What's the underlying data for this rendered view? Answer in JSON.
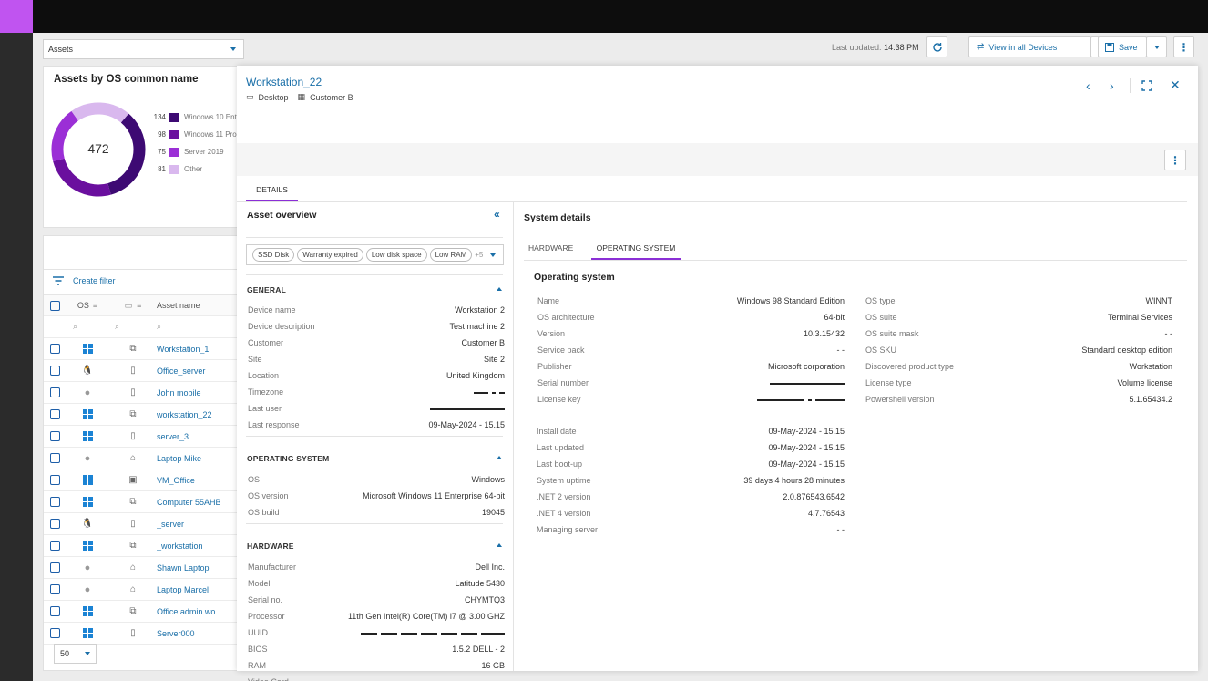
{
  "header": {
    "dropdown_value": "Assets",
    "last_updated_label": "Last updated:",
    "last_updated_time": "14:38 PM",
    "view_all_label": "View in all Devices",
    "save_label": "Save"
  },
  "os_card": {
    "title": "Assets by OS common name",
    "total": "472",
    "legend": [
      {
        "count": "134",
        "label": "Windows 10 Ent",
        "color": "#3d0a73"
      },
      {
        "count": "98",
        "label": "Windows 11 Pro",
        "color": "#6a0f9e"
      },
      {
        "count": "75",
        "label": "Server 2019",
        "color": "#9b2fd6"
      },
      {
        "count": "81",
        "label": "Other",
        "color": "#d9b8ee"
      }
    ]
  },
  "table": {
    "create_filter": "Create filter",
    "col_os": "OS",
    "col_asset": "Asset name",
    "rows": [
      {
        "os": "windows",
        "type": "desktop",
        "name": "Workstation_1"
      },
      {
        "os": "linux",
        "type": "mobile",
        "name": "Office_server"
      },
      {
        "os": "apple",
        "type": "mobile",
        "name": "John mobile"
      },
      {
        "os": "windows",
        "type": "desktop",
        "name": "workstation_22"
      },
      {
        "os": "windows",
        "type": "mobile",
        "name": "server_3"
      },
      {
        "os": "apple",
        "type": "laptop",
        "name": "Laptop Mike"
      },
      {
        "os": "windows",
        "type": "vm",
        "name": "VM_Office"
      },
      {
        "os": "windows",
        "type": "desktop",
        "name": "Computer 55AHB"
      },
      {
        "os": "linux",
        "type": "mobile",
        "name": "_server"
      },
      {
        "os": "windows",
        "type": "desktop",
        "name": "_workstation"
      },
      {
        "os": "apple",
        "type": "laptop",
        "name": "Shawn Laptop"
      },
      {
        "os": "apple",
        "type": "laptop",
        "name": "Laptop Marcel"
      },
      {
        "os": "windows",
        "type": "desktop",
        "name": "Office admin wo"
      },
      {
        "os": "windows",
        "type": "mobile",
        "name": "Server000"
      }
    ],
    "page_size": "50"
  },
  "panel": {
    "title": "Workstation_22",
    "type_label": "Desktop",
    "customer_label": "Customer B",
    "tab_details": "DETAILS",
    "asset_overview_title": "Asset overview",
    "tags": [
      "SSD Disk",
      "Warranty expired",
      "Low disk space",
      "Low RAM"
    ],
    "tags_more": "+5",
    "general": {
      "title": "GENERAL",
      "items": [
        {
          "k": "Device name",
          "v": "Workstation 2"
        },
        {
          "k": "Device description",
          "v": "Test machine 2"
        },
        {
          "k": "Customer",
          "v": "Customer B"
        },
        {
          "k": "Site",
          "v": "Site 2"
        },
        {
          "k": "Location",
          "v": "United Kingdom"
        },
        {
          "k": "Timezone",
          "v": ""
        },
        {
          "k": "Last user",
          "v": ""
        },
        {
          "k": "Last response",
          "v": "09-May-2024 - 15.15"
        }
      ]
    },
    "os_section": {
      "title": "OPERATING SYSTEM",
      "items": [
        {
          "k": "OS",
          "v": "Windows"
        },
        {
          "k": "OS version",
          "v": "Microsoft Windows 11 Enterprise 64-bit"
        },
        {
          "k": "OS build",
          "v": "19045"
        }
      ]
    },
    "hardware": {
      "title": "HARDWARE",
      "items": [
        {
          "k": "Manufacturer",
          "v": "Dell Inc."
        },
        {
          "k": "Model",
          "v": "Latitude 5430"
        },
        {
          "k": "Serial no.",
          "v": "CHYMTQ3"
        },
        {
          "k": "Processor",
          "v": "11th Gen Intel(R) Core(TM) i7 @ 3.00 GHZ"
        },
        {
          "k": "UUID",
          "v": ""
        },
        {
          "k": "BIOS",
          "v": "1.5.2 DELL - 2"
        },
        {
          "k": "RAM",
          "v": "16 GB"
        },
        {
          "k": "Video Card",
          "v": ""
        }
      ]
    },
    "system_details": {
      "title": "System details",
      "tab_hardware": "HARDWARE",
      "tab_os": "OPERATING SYSTEM",
      "os_title": "Operating system",
      "left1": [
        {
          "k": "Name",
          "v": "Windows 98 Standard Edition"
        },
        {
          "k": "OS architecture",
          "v": "64-bit"
        },
        {
          "k": "Version",
          "v": "10.3.15432"
        },
        {
          "k": "Service pack",
          "v": "- -"
        },
        {
          "k": "Publisher",
          "v": "Microsoft corporation"
        },
        {
          "k": "Serial number",
          "v": ""
        },
        {
          "k": "License key",
          "v": ""
        }
      ],
      "left2": [
        {
          "k": "Install date",
          "v": "09-May-2024 - 15.15"
        },
        {
          "k": "Last updated",
          "v": "09-May-2024 - 15.15"
        },
        {
          "k": "Last boot-up",
          "v": "09-May-2024 - 15.15"
        },
        {
          "k": "System uptime",
          "v": "39 days 4 hours 28 minutes"
        },
        {
          "k": ".NET 2 version",
          "v": "2.0.876543.6542"
        },
        {
          "k": ".NET 4 version",
          "v": "4.7.76543"
        },
        {
          "k": "Managing server",
          "v": "- -"
        }
      ],
      "right": [
        {
          "k": "OS type",
          "v": "WINNT"
        },
        {
          "k": "OS suite",
          "v": "Terminal Services"
        },
        {
          "k": "OS suite mask",
          "v": "- -"
        },
        {
          "k": "OS SKU",
          "v": "Standard desktop edition"
        },
        {
          "k": "Discovered product type",
          "v": "Workstation"
        },
        {
          "k": "License type",
          "v": "Volume license"
        },
        {
          "k": "Powershell version",
          "v": "5.1.65434.2"
        }
      ]
    }
  }
}
